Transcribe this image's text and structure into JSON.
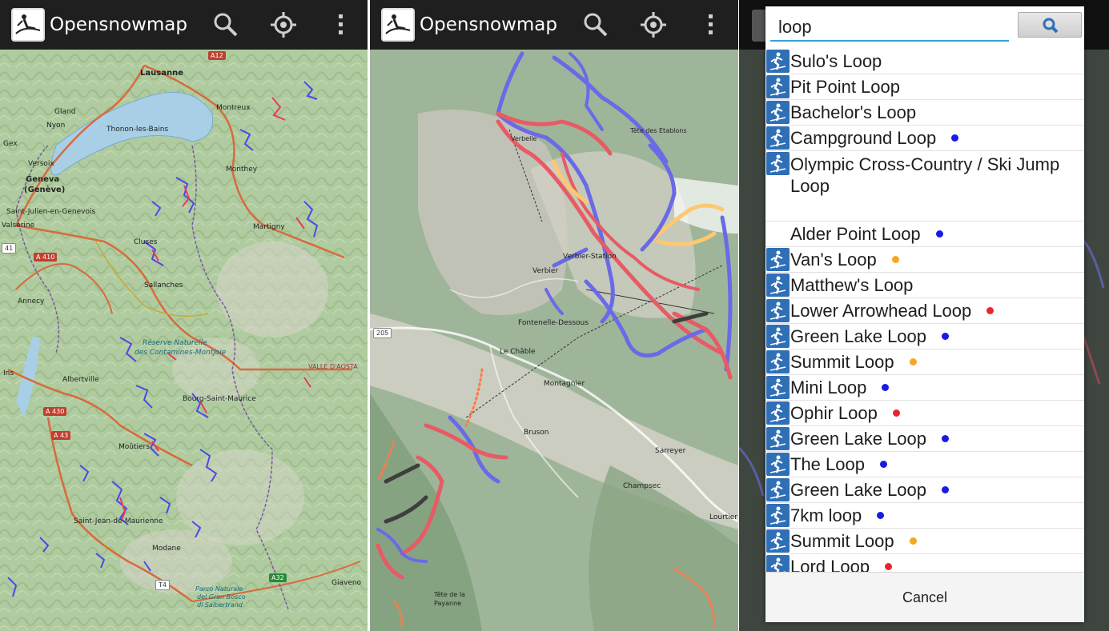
{
  "app": {
    "title": "Opensnowmap",
    "icons": [
      "skier-logo-icon",
      "search-icon",
      "gps-locate-icon",
      "overflow-menu-icon"
    ]
  },
  "panel1": {
    "places": [
      "Lausanne",
      "Gland",
      "Montreux",
      "Nyon",
      "Thonon-les-Bains",
      "Gex",
      "Versoix",
      "Geneva",
      "(Genève)",
      "Monthey",
      "Saint-Julien-en-Genevois",
      "Martigny",
      "Valserine",
      "Cluses",
      "Sallanches",
      "Annecy",
      "Réserve Naturelle",
      "des Contamines-Montjoie",
      "VALLE D'AOSTA",
      "Albertville",
      "Bourg-Saint-Maurice",
      "Moûtiers",
      "Saint-Jean-de-Maurienne",
      "Modane",
      "Parco Naturale",
      "del Gran Bosco",
      "di Salbertrand",
      "Giaveno",
      "Ins"
    ],
    "roads": [
      "A12",
      "A 410",
      "41",
      "A 430",
      "A 43",
      "T4",
      "A32"
    ]
  },
  "panel2": {
    "places": [
      "Tête des Etablons",
      "Verbier",
      "Verbier-Station",
      "Fontenelle-Dessous",
      "Le Châble",
      "Montagnier",
      "Bruson",
      "Sarreyer",
      "Champsec",
      "Lourtier",
      "Tête de la",
      "Payanne",
      "Verbelle"
    ],
    "roads": [
      "205"
    ]
  },
  "search": {
    "query": "loop",
    "button": "search-icon"
  },
  "results": [
    {
      "name": "Sulo's Loop",
      "icon": true,
      "dot": null
    },
    {
      "name": "Pit Point Loop",
      "icon": true,
      "dot": null
    },
    {
      "name": "Bachelor's Loop",
      "icon": true,
      "dot": null
    },
    {
      "name": "Campground Loop",
      "icon": true,
      "dot": "#1a1ae6"
    },
    {
      "name": "Olympic Cross-Country / Ski Jump Loop",
      "icon": true,
      "dot": null,
      "tall": true
    },
    {
      "name": "Alder Point Loop",
      "icon": false,
      "dot": "#1a1ae6"
    },
    {
      "name": "Van's Loop",
      "icon": true,
      "dot": "#f5a623"
    },
    {
      "name": "Matthew's Loop",
      "icon": true,
      "dot": null
    },
    {
      "name": "Lower Arrowhead Loop",
      "icon": true,
      "dot": "#e8262a"
    },
    {
      "name": "Green Lake Loop",
      "icon": true,
      "dot": "#1a1ae6"
    },
    {
      "name": "Summit Loop",
      "icon": true,
      "dot": "#f5a623"
    },
    {
      "name": "Mini Loop",
      "icon": true,
      "dot": "#1a1ae6"
    },
    {
      "name": "Ophir Loop",
      "icon": true,
      "dot": "#e8262a"
    },
    {
      "name": "Green Lake Loop",
      "icon": true,
      "dot": "#1a1ae6"
    },
    {
      "name": "The Loop",
      "icon": true,
      "dot": "#1a1ae6"
    },
    {
      "name": "Green Lake Loop",
      "icon": true,
      "dot": "#1a1ae6"
    },
    {
      "name": "7km loop",
      "icon": true,
      "dot": "#1a1ae6"
    },
    {
      "name": "Summit Loop",
      "icon": true,
      "dot": "#f5a623"
    },
    {
      "name": "Lord Loop",
      "icon": true,
      "dot": "#e8262a"
    }
  ],
  "cancel_label": "Cancel",
  "colors": {
    "appbar": "#1f1f1f",
    "accent": "#36a3d8",
    "result_icon": "#2f6fb6",
    "piste_blue": "#1a1ae6",
    "piste_red": "#e8262a",
    "piste_orange": "#f5a623"
  }
}
